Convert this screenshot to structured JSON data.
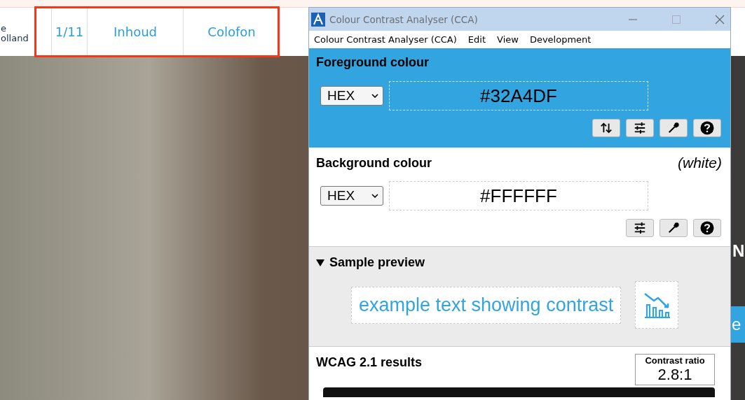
{
  "website": {
    "logo_lines": [
      "e",
      "olland"
    ],
    "nav": [
      {
        "label": "1/11"
      },
      {
        "label": "Inhoud"
      },
      {
        "label": "Colofon"
      }
    ],
    "banner_texts": [
      "N",
      "e"
    ]
  },
  "window": {
    "title": "Colour Contrast Analyser (CCA)",
    "menu": [
      "Colour Contrast Analyser (CCA)",
      "Edit",
      "View",
      "Development"
    ],
    "foreground": {
      "heading": "Foreground colour",
      "format": "HEX",
      "value": "#32A4DF",
      "tools": [
        {
          "kind": "swap"
        },
        {
          "kind": "sliders"
        },
        {
          "kind": "picker"
        },
        {
          "kind": "help"
        }
      ]
    },
    "background": {
      "heading": "Background colour",
      "name": "(white)",
      "format": "HEX",
      "value": "#FFFFFF",
      "tools": [
        {
          "kind": "sliders"
        },
        {
          "kind": "picker"
        },
        {
          "kind": "help"
        }
      ]
    },
    "sample_preview": {
      "heading": "Sample preview",
      "expanded": true,
      "text": "example text showing contrast"
    },
    "results": {
      "heading": "WCAG 2.1 results",
      "ratio_label": "Contrast ratio",
      "ratio": "2.8:1"
    }
  }
}
